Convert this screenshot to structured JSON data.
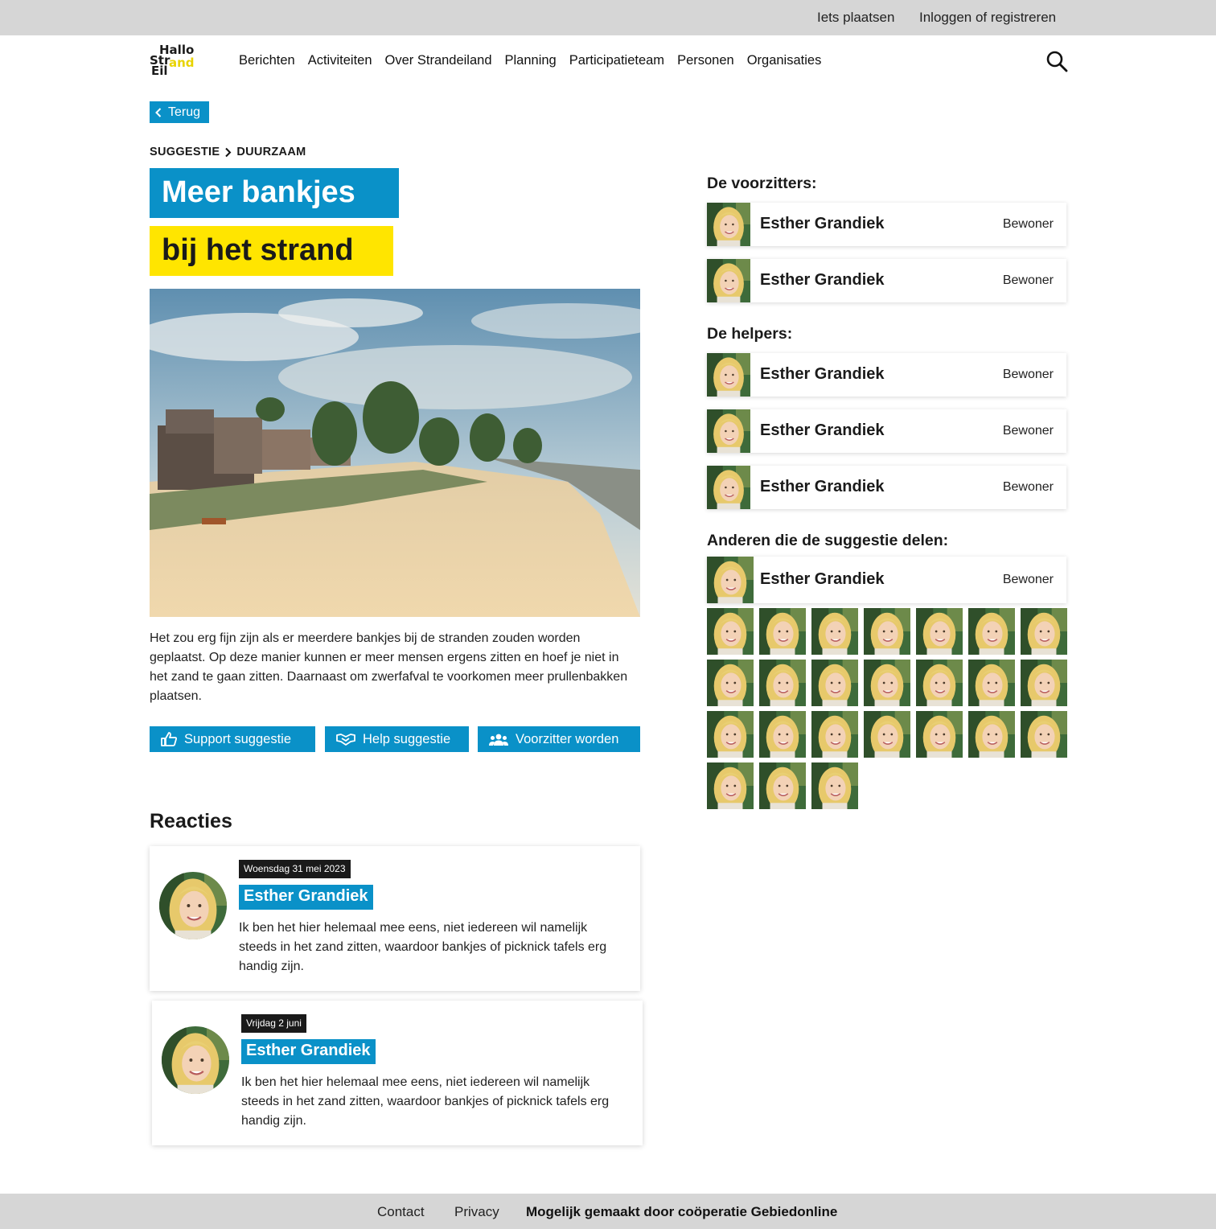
{
  "topbar": {
    "post": "Iets plaatsen",
    "login": "Inloggen of registreren"
  },
  "logo": {
    "line1": "Hallo",
    "line2": "Str",
    "line2b": "and",
    "line3": "Eil"
  },
  "nav": [
    "Berichten",
    "Activiteiten",
    "Over Strandeiland",
    "Planning",
    "Participatieteam",
    "Personen",
    "Organisaties"
  ],
  "back_label": "Terug",
  "breadcrumb": {
    "category": "SUGGESTIE",
    "sub": "DUURZAAM"
  },
  "title": {
    "line1": "Meer bankjes",
    "line2": "bij het strand"
  },
  "description": "Het zou erg fijn zijn als er meerdere bankjes bij de stranden zouden worden geplaatst. Op deze manier kunnen er meer mensen ergens zitten en hoef je niet in het zand te gaan zitten. Daarnaast om zwerfafval te voorkomen meer prullenbakken plaatsen.",
  "actions": {
    "support": "Support suggestie",
    "help": "Help suggestie",
    "chair": "Voorzitter worden"
  },
  "reacties": {
    "heading": "Reacties",
    "items": [
      {
        "date": "Woensdag 31 mei 2023",
        "name": "Esther Grandiek",
        "text": "Ik ben het hier helemaal mee eens, niet iedereen wil namelijk steeds in het zand zitten, waardoor bankjes of picknick tafels erg handig zijn."
      },
      {
        "date": "Vrijdag 2 juni",
        "name": "Esther Grandiek",
        "text": "Ik ben het hier helemaal mee eens, niet iedereen wil namelijk steeds in het zand zitten, waardoor bankjes of picknick tafels erg handig zijn."
      }
    ]
  },
  "sidebar": {
    "chairs_heading": "De voorzitters:",
    "chairs": [
      {
        "name": "Esther Grandiek",
        "role": "Bewoner"
      },
      {
        "name": "Esther Grandiek",
        "role": "Bewoner"
      }
    ],
    "helpers_heading": "De helpers:",
    "helpers": [
      {
        "name": "Esther Grandiek",
        "role": "Bewoner"
      },
      {
        "name": "Esther Grandiek",
        "role": "Bewoner"
      },
      {
        "name": "Esther Grandiek",
        "role": "Bewoner"
      }
    ],
    "sharers_heading": "Anderen die de suggestie delen:",
    "sharer_featured": {
      "name": "Esther Grandiek",
      "role": "Bewoner"
    },
    "sharer_avatar_count": 24
  },
  "footer": {
    "contact": "Contact",
    "privacy": "Privacy",
    "made_by": "Mogelijk gemaakt door coöperatie Gebiedonline"
  },
  "colors": {
    "blue": "#0a91c8",
    "yellow": "#ffe500",
    "gray": "#d6d6d6"
  }
}
